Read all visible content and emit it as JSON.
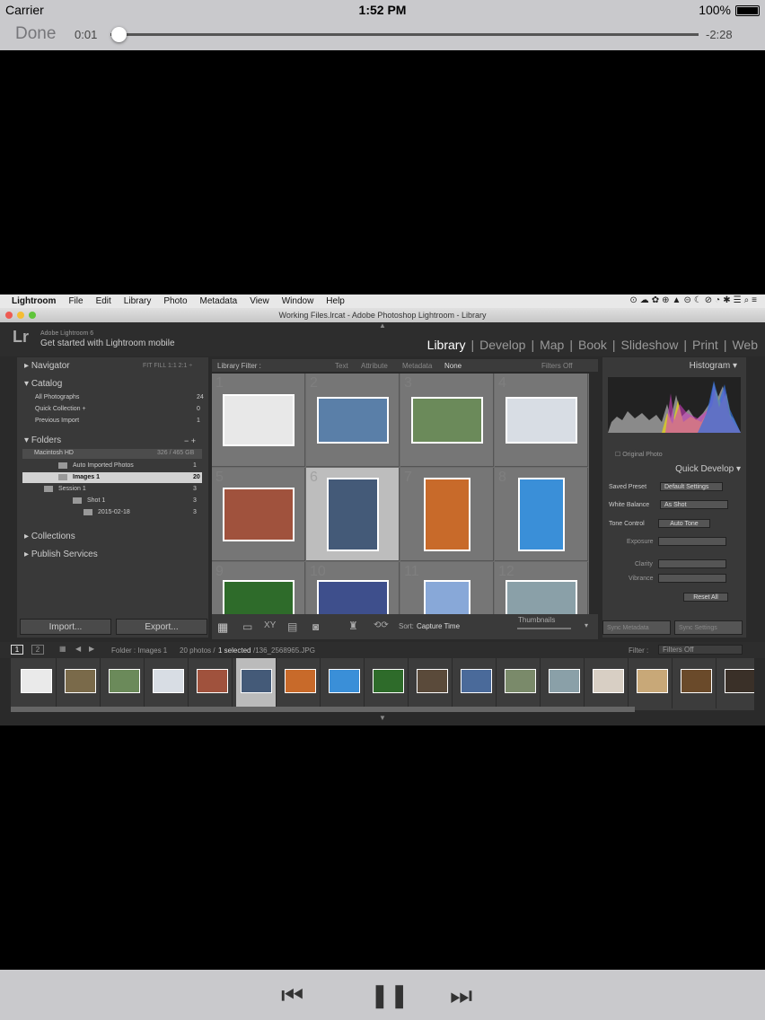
{
  "status": {
    "carrier": "Carrier",
    "time": "1:52 PM",
    "battery": "100%"
  },
  "player": {
    "done_label": "Done",
    "elapsed": "0:01",
    "remaining": "-2:28",
    "progress": 0.007,
    "prev_label": "⏮",
    "pause_label": "❚❚",
    "next_label": "⏭"
  },
  "mac_menu": [
    "Lightroom",
    "File",
    "Edit",
    "Library",
    "Photo",
    "Metadata",
    "View",
    "Window",
    "Help"
  ],
  "window_title": "Working Files.lrcat - Adobe Photoshop Lightroom - Library",
  "lightroom": {
    "logo": "Lr",
    "version": "Adobe Lightroom 6",
    "mobile_prompt": "Get started with Lightroom mobile",
    "modules": [
      "Library",
      "|",
      "Develop",
      "|",
      "Map",
      "|",
      "Book",
      "|",
      "Slideshow",
      "|",
      "Print",
      "|",
      "Web"
    ],
    "active_module": "Library"
  },
  "left_panel": {
    "navigator": "Navigator",
    "nav_zoom": "FIT  FILL  1:1  2:1 ÷",
    "catalog": "Catalog",
    "catalog_rows": [
      {
        "label": "All Photographs",
        "count": "24"
      },
      {
        "label": "Quick Collection  +",
        "count": "0"
      },
      {
        "label": "Previous Import",
        "count": "1"
      }
    ],
    "folders": "Folders",
    "drive": "Macintosh HD",
    "drive_space": "326 / 465 GB",
    "folder_rows": [
      {
        "label": "Auto Imported Photos",
        "count": "1"
      },
      {
        "label": "Images 1",
        "count": "20"
      },
      {
        "label": "Session 1",
        "count": "3"
      },
      {
        "label": "Shot 1",
        "count": "3"
      },
      {
        "label": "2015-02-18",
        "count": "3"
      }
    ],
    "collections": "Collections",
    "publish": "Publish Services",
    "import_label": "Import...",
    "export_label": "Export..."
  },
  "grid": {
    "filter_label": "Library Filter :",
    "filter_opts": [
      "Text",
      "Attribute",
      "Metadata",
      "None"
    ],
    "filters_off": "Filters Off",
    "sort_label": "Sort:",
    "sort_value": "Capture Time",
    "thumbs_label": "Thumbnails",
    "cell_numbers": [
      "1",
      "2",
      "3",
      "4",
      "5",
      "6",
      "7",
      "8",
      "9",
      "10",
      "11",
      "12"
    ],
    "thumb_colors": [
      "#e8e8e8",
      "#5a7fa8",
      "#6b8a5a",
      "#d8dde4",
      "#a0523d",
      "#445a78",
      "#c86a2a",
      "#3a8fd8",
      "#2e6b2a",
      "#3e4f8c",
      "#88a8d8",
      "#8aa0a8"
    ]
  },
  "right_panel": {
    "histogram": "Histogram",
    "original_photo": "Original Photo",
    "quick_develop": "Quick Develop",
    "saved_preset_label": "Saved Preset",
    "saved_preset_value": "Default Settings",
    "white_balance_label": "White Balance",
    "white_balance_value": "As Shot",
    "tone_control_label": "Tone Control",
    "auto_tone": "Auto Tone",
    "exposure": "Exposure",
    "clarity": "Clarity",
    "vibrance": "Vibrance",
    "reset_all": "Reset All",
    "sync_metadata": "Sync Metadata",
    "sync_settings": "Sync Settings"
  },
  "filmstrip": {
    "page1": "1",
    "page2": "2",
    "source": "Folder : Images 1",
    "count_text": "20 photos /",
    "selected_text": "1 selected",
    "file_text": "/136_2568965.JPG",
    "filter_label": "Filter :",
    "filter_value": "Filters Off",
    "thumb_colors": [
      "#eaeaea",
      "#7a6a4a",
      "#6b8a5a",
      "#d8dde4",
      "#a0523d",
      "#445a78",
      "#c86a2a",
      "#3a8fd8",
      "#2e6b2a",
      "#5a4a3a",
      "#4a6a9a",
      "#7a8a6a",
      "#8aa0a8",
      "#d8cfc4",
      "#c8a878",
      "#6a4a2a",
      "#3a3028"
    ]
  }
}
